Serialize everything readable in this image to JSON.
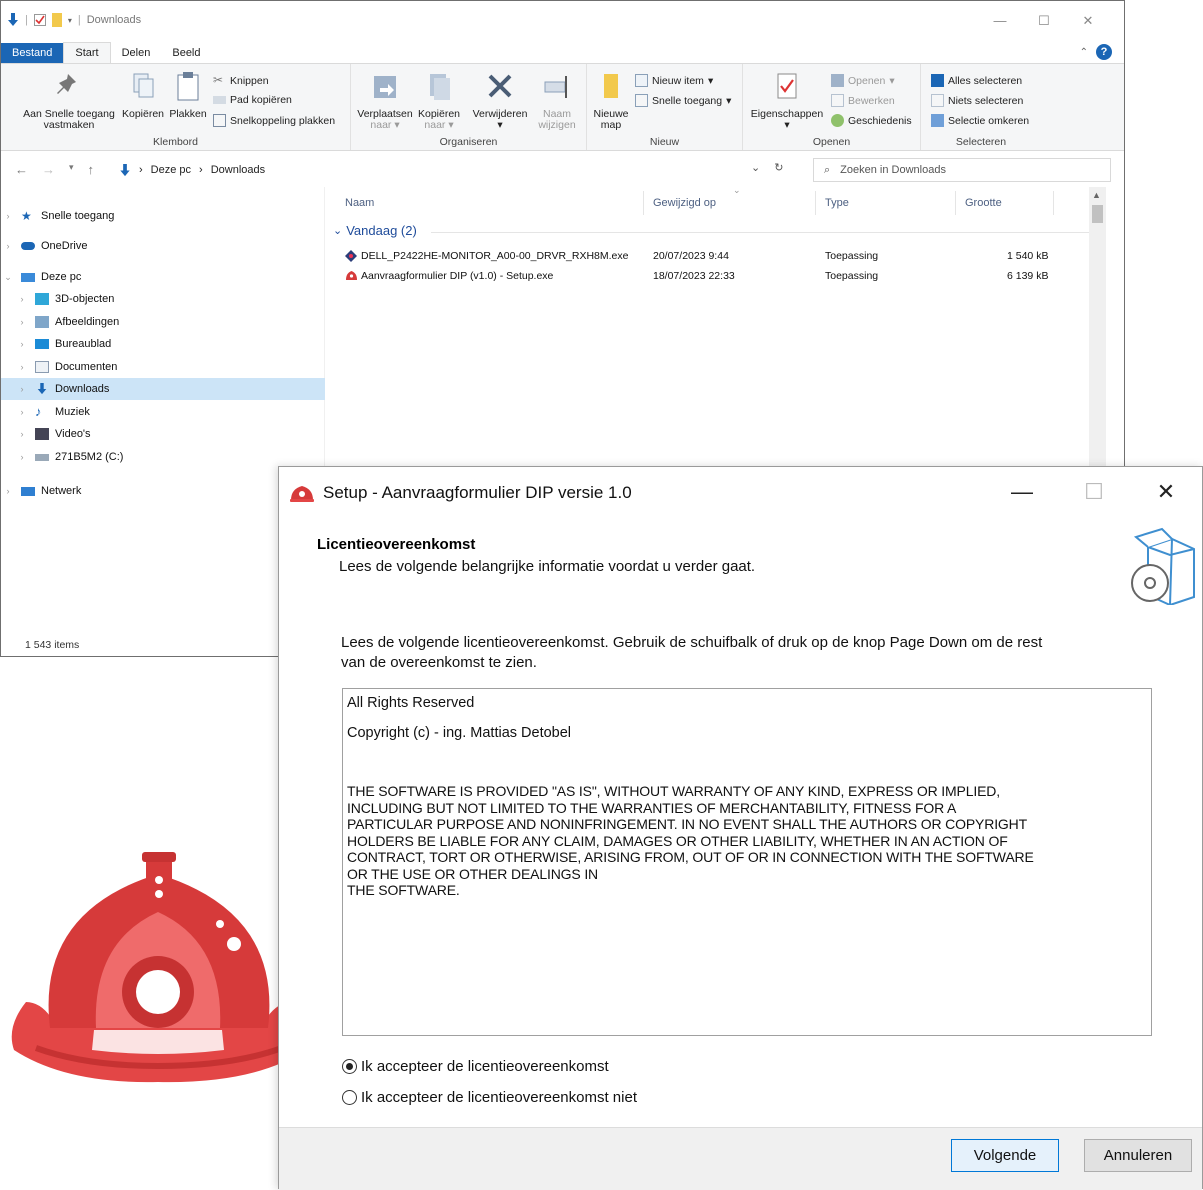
{
  "explorer": {
    "title": "Downloads",
    "tabs": [
      "Bestand",
      "Start",
      "Delen",
      "Beeld"
    ],
    "clipboard": {
      "pin_label_1": "Aan Snelle toegang",
      "pin_label_2": "vastmaken",
      "copy": "Kopiëren",
      "paste": "Plakken",
      "cut": "Knippen",
      "copy_path": "Pad kopiëren",
      "paste_shortcut": "Snelkoppeling plakken",
      "group": "Klembord"
    },
    "organize": {
      "move_1": "Verplaatsen",
      "move_2": "naar",
      "copyto_1": "Kopiëren",
      "copyto_2": "naar",
      "delete": "Verwijderen",
      "rename_1": "Naam",
      "rename_2": "wijzigen",
      "group": "Organiseren"
    },
    "new": {
      "folder_1": "Nieuwe",
      "folder_2": "map",
      "new_item": "Nieuw item",
      "easy_access": "Snelle toegang",
      "group": "Nieuw"
    },
    "open": {
      "properties": "Eigenschappen",
      "open": "Openen",
      "edit": "Bewerken",
      "history": "Geschiedenis",
      "group": "Openen"
    },
    "select": {
      "all": "Alles selecteren",
      "none": "Niets selecteren",
      "invert": "Selectie omkeren",
      "group": "Selecteren"
    },
    "breadcrumb": [
      "Deze pc",
      "Downloads"
    ],
    "search_placeholder": "Zoeken in Downloads",
    "nav": [
      {
        "label": "Snelle toegang",
        "icon": "star-icon"
      },
      {
        "label": "OneDrive",
        "icon": "cloud-icon"
      },
      {
        "label": "Deze pc",
        "icon": "computer-icon"
      },
      {
        "label": "3D-objecten",
        "icon": "cube-icon"
      },
      {
        "label": "Afbeeldingen",
        "icon": "pictures-icon"
      },
      {
        "label": "Bureaublad",
        "icon": "desktop-icon"
      },
      {
        "label": "Documenten",
        "icon": "document-icon"
      },
      {
        "label": "Downloads",
        "icon": "download-icon"
      },
      {
        "label": "Muziek",
        "icon": "music-icon"
      },
      {
        "label": "Video's",
        "icon": "video-icon"
      },
      {
        "label": "271B5M2 (C:)",
        "icon": "drive-icon"
      },
      {
        "label": "Netwerk",
        "icon": "network-icon"
      }
    ],
    "columns": {
      "name": "Naam",
      "modified": "Gewijzigd op",
      "type": "Type",
      "size": "Grootte"
    },
    "group_header": "Vandaag (2)",
    "files": [
      {
        "name": "DELL_P2422HE-MONITOR_A00-00_DRVR_RXH8M.exe",
        "modified": "20/07/2023 9:44",
        "type": "Toepassing",
        "size": "1 540 kB"
      },
      {
        "name": "Aanvraagformulier DIP (v1.0) - Setup.exe",
        "modified": "18/07/2023 22:33",
        "type": "Toepassing",
        "size": "6 139 kB"
      }
    ],
    "status": "1 543 items"
  },
  "setup": {
    "title": "Setup - Aanvraagformulier DIP versie 1.0",
    "heading": "Licentieovereenkomst",
    "subheading": "Lees de volgende belangrijke informatie voordat u verder gaat.",
    "intro_1": "Lees de volgende licentieovereenkomst. Gebruik de schuifbalk of druk op de knop Page Down om de rest",
    "intro_2": "van de overeenkomst te zien.",
    "license_line1": "All Rights Reserved",
    "license_line2": "Copyright (c) - ing. Mattias Detobel",
    "license_legal": [
      "THE SOFTWARE IS PROVIDED \"AS IS\", WITHOUT WARRANTY OF ANY KIND, EXPRESS OR IMPLIED,",
      "INCLUDING BUT NOT LIMITED TO THE WARRANTIES OF MERCHANTABILITY, FITNESS FOR A",
      "PARTICULAR PURPOSE AND NONINFRINGEMENT. IN NO EVENT SHALL THE AUTHORS OR COPYRIGHT",
      "HOLDERS BE LIABLE FOR ANY CLAIM, DAMAGES OR OTHER LIABILITY, WHETHER IN AN ACTION OF",
      "CONTRACT, TORT OR OTHERWISE, ARISING FROM, OUT OF OR IN CONNECTION WITH THE SOFTWARE",
      "OR THE USE OR OTHER DEALINGS IN",
      "THE SOFTWARE."
    ],
    "accept": "Ik accepteer de licentieovereenkomst",
    "decline": "Ik accepteer de licentieovereenkomst niet",
    "accept_selected": true,
    "next_button": "Volgende",
    "cancel_button": "Annuleren"
  },
  "colors": {
    "accent": "#1b66b5",
    "selection": "#cce4f7",
    "helmet_red": "#d63a3a"
  }
}
